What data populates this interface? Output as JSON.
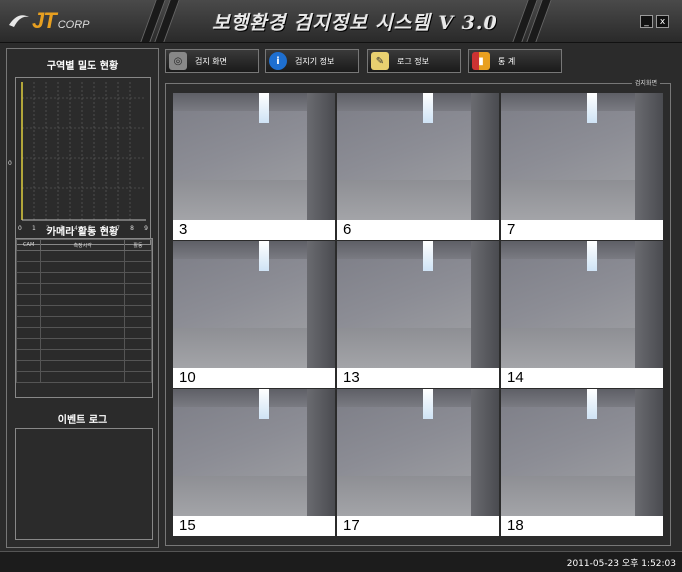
{
  "app": {
    "logo_main": "JT",
    "logo_sub": "CORP",
    "title": "보행환경 검지정보 시스템 V 3.0",
    "minimize_label": "_",
    "close_label": "x"
  },
  "left": {
    "activity_title": "구역별 밀도 현황",
    "graph": {
      "y_tick": "0",
      "x_ticks": [
        "0",
        "1",
        "2",
        "3",
        "4",
        "5",
        "6",
        "7",
        "8",
        "9"
      ]
    },
    "camera_title": "카메라 활동 현황",
    "camera_table": {
      "headers": [
        "CAM",
        "측정시각",
        "활동"
      ],
      "rows": 12
    },
    "event_title": "이벤트 로그"
  },
  "toolbar": {
    "buttons": [
      {
        "label": "검지 화면",
        "icon": "monitor-icon"
      },
      {
        "label": "검지기 정보",
        "icon": "info-icon"
      },
      {
        "label": "로그 정보",
        "icon": "log-icon"
      },
      {
        "label": "통 계",
        "icon": "stats-icon"
      }
    ]
  },
  "main": {
    "title": "검지화면",
    "cameras": [
      "3",
      "6",
      "7",
      "10",
      "13",
      "14",
      "15",
      "17",
      "18"
    ]
  },
  "status": {
    "datetime": "2011-05-23 오후 1:52:03"
  }
}
